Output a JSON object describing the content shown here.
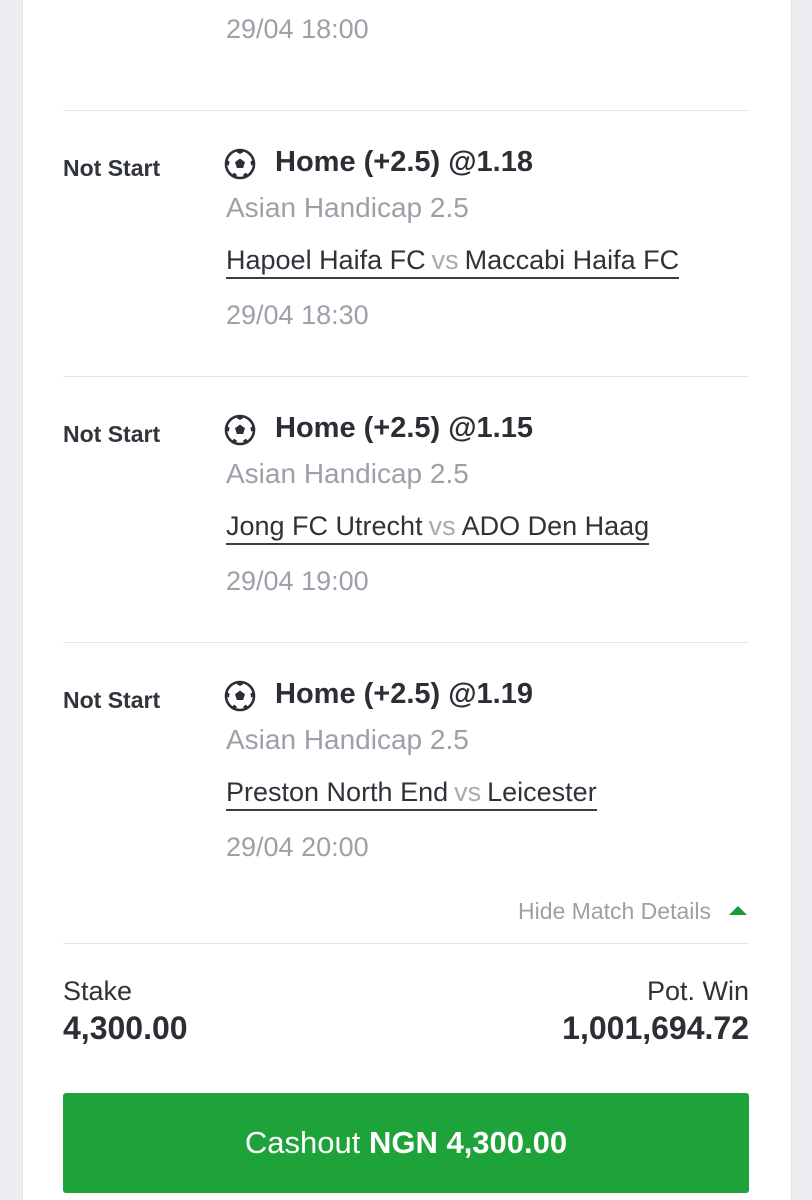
{
  "top_time": "29/04 18:00",
  "bets": [
    {
      "status": "Not Start",
      "sport_icon": "soccer-ball-icon",
      "pick": "Home (+2.5) @1.18",
      "market": "Asian Handicap 2.5",
      "home_team": "Hapoel Haifa FC",
      "vs": "vs",
      "away_team": "Maccabi Haifa FC",
      "time": "29/04 18:30"
    },
    {
      "status": "Not Start",
      "sport_icon": "soccer-ball-icon",
      "pick": "Home (+2.5) @1.15",
      "market": "Asian Handicap 2.5",
      "home_team": "Jong FC Utrecht",
      "vs": "vs",
      "away_team": "ADO Den Haag",
      "time": "29/04 19:00"
    },
    {
      "status": "Not Start",
      "sport_icon": "soccer-ball-icon",
      "pick": "Home (+2.5) @1.19",
      "market": "Asian Handicap 2.5",
      "home_team": "Preston North End",
      "vs": "vs",
      "away_team": "Leicester",
      "time": "29/04 20:00"
    }
  ],
  "details_toggle": {
    "label": "Hide Match Details",
    "icon": "caret-up-icon"
  },
  "summary": {
    "stake_label": "Stake",
    "stake_value": "4,300.00",
    "potwin_label": "Pot. Win",
    "potwin_value": "1,001,694.72"
  },
  "cashout": {
    "label": "Cashout",
    "amount": "NGN 4,300.00"
  },
  "colors": {
    "accent_green": "#1ea23a",
    "muted_text": "#9ca0a8",
    "primary_text": "#2b2e35"
  }
}
